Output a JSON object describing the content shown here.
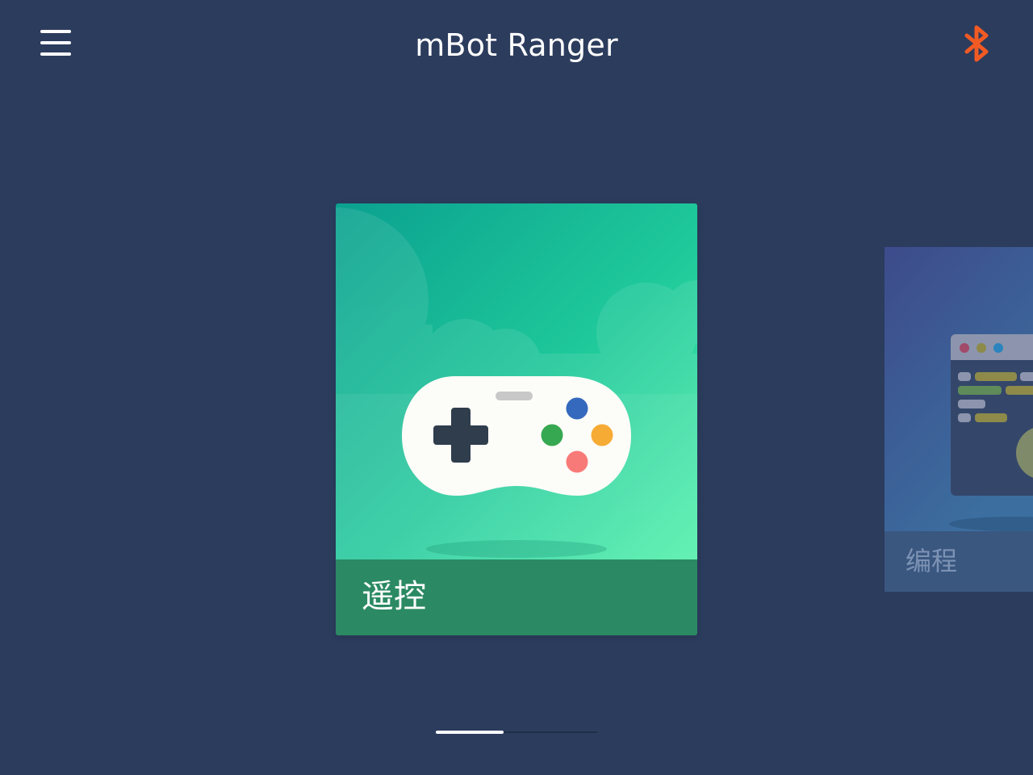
{
  "header": {
    "title": "mBot Ranger",
    "menu_icon": "hamburger-menu-icon",
    "bluetooth_icon": "bluetooth-icon",
    "bluetooth_color": "#f25a24"
  },
  "cards": [
    {
      "label": "遥控",
      "icon": "gamepad-icon",
      "gradient_start": "#0ea693",
      "gradient_end": "#4bf0a8",
      "label_bar_color": "#2b8a63"
    },
    {
      "label": "编程",
      "icon": "code-window-icon",
      "gradient_start": "#3e4d8c",
      "gradient_end": "#3e6ea0",
      "label_bar_color": "#3a5780"
    }
  ],
  "pager": {
    "current_page": 1,
    "total_pages": 2
  },
  "colors": {
    "background": "#2c3c5d",
    "accent": "#f25a24"
  }
}
